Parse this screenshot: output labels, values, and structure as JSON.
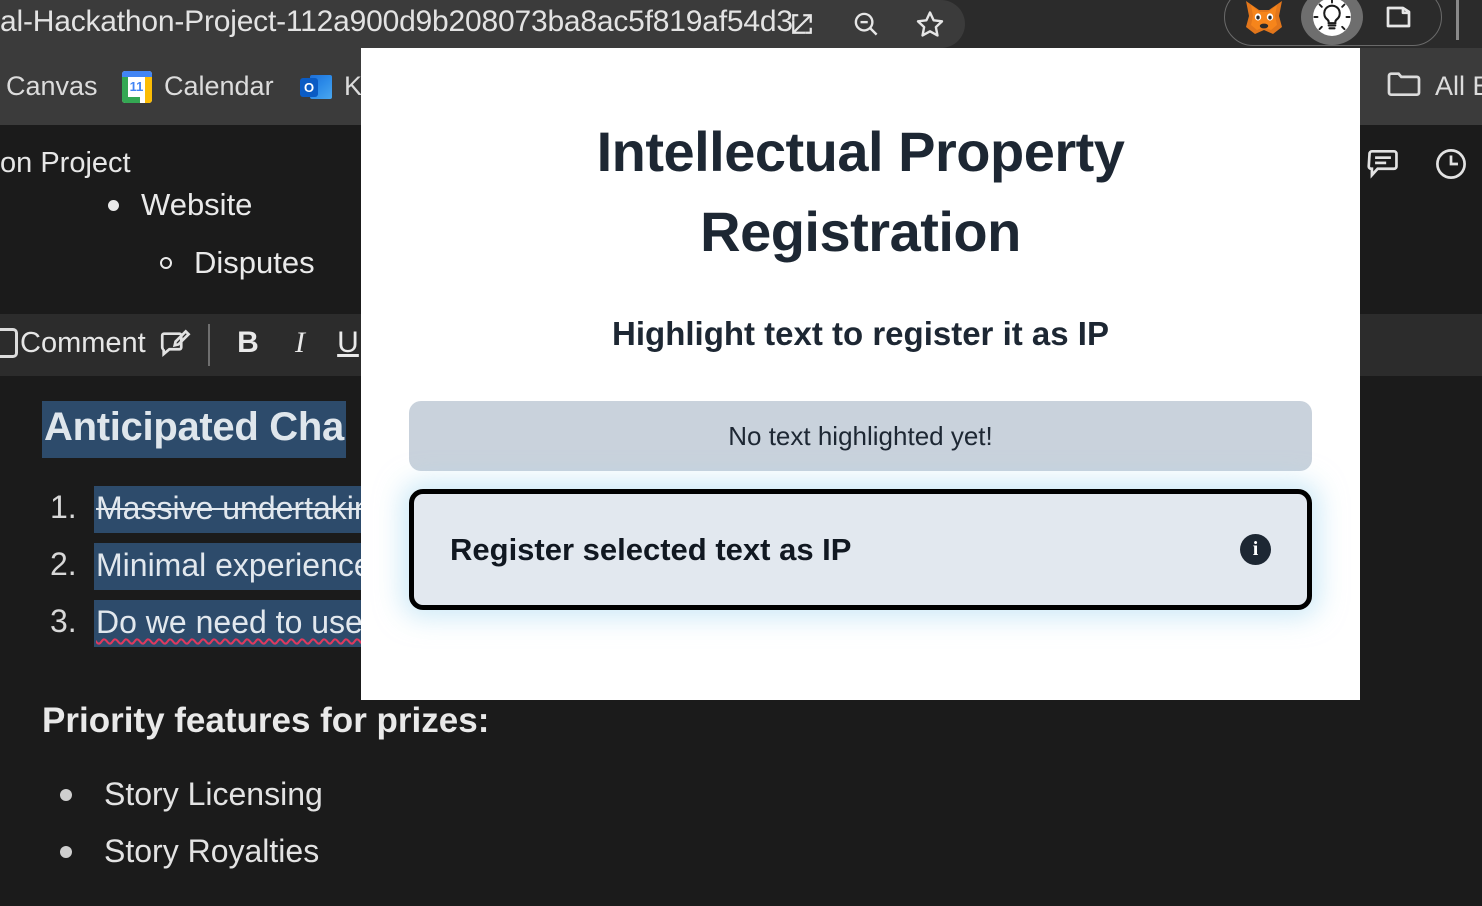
{
  "browser": {
    "url": "al-Hackathon-Project-112a900d9b208073ba8ac5f819af54d3",
    "toolbar_icons": [
      {
        "name": "open-in-new-icon",
        "label": "Open in new window"
      },
      {
        "name": "zoom-out-icon",
        "label": "Zoom out"
      },
      {
        "name": "bookmark-star-icon",
        "label": "Bookmark this tab"
      }
    ],
    "extensions": [
      {
        "name": "metamask-fox-icon",
        "label": "MetaMask",
        "active": false
      },
      {
        "name": "lightbulb-icon",
        "label": "Lightbulb Extension",
        "active": true
      },
      {
        "name": "extension-puzzle-icon",
        "label": "Extensions",
        "active": false
      }
    ]
  },
  "bookmarks": {
    "items": [
      {
        "label": "Canvas",
        "icon": ""
      },
      {
        "label": "Calendar",
        "icon": "google-calendar-icon",
        "day": "11"
      },
      {
        "label": "K",
        "icon": "outlook-icon"
      }
    ],
    "all_bookmarks_label": "All B",
    "all_bookmarks_icon": "folder-icon"
  },
  "document": {
    "breadcrumb": "on Project",
    "outline": [
      {
        "label": "Website",
        "bullet": "filled"
      },
      {
        "label": "Disputes",
        "bullet": "hollow"
      }
    ],
    "toolbar": {
      "comment_label": "Comment",
      "add_comment_icon": "comment-edit-icon",
      "bold_label": "B",
      "italic_label": "I",
      "underline_label": "U"
    },
    "right_icons": [
      {
        "name": "comments-panel-icon"
      },
      {
        "name": "version-history-clock-icon"
      }
    ],
    "heading": "Anticipated Cha",
    "numbered_list": [
      {
        "number": "1.",
        "text": "Massive undertaking",
        "strikethrough": true
      },
      {
        "number": "2.",
        "text": "Minimal experience v",
        "strikethrough": false
      },
      {
        "number": "3.",
        "text": "Do we need to use L",
        "strikethrough": false,
        "spellcheck_error": "L"
      }
    ],
    "priority_heading": "Priority features for prizes:",
    "priority_items": [
      "Story Licensing",
      "Story Royalties"
    ]
  },
  "modal": {
    "title": "Intellectual Property Registration",
    "subtitle": "Highlight text to register it as IP",
    "highlight_status": "No text highlighted yet!",
    "register_button_label": "Register selected text as IP",
    "info_icon_label": "i"
  },
  "colors": {
    "modal_bg": "#ffffff",
    "title_text": "#1d2733",
    "status_bg": "#c9d2dc",
    "button_bg": "#e2e8ef",
    "button_border": "#000000",
    "button_glow": "#a8d8f0",
    "selection_highlight": "#2d4b6b",
    "page_bg": "#1b1b1b",
    "chrome_bg": "#2b2b2b",
    "bookmarkbar_bg": "#3b3b3b",
    "toolbar_bg": "#2c2c2c",
    "spellcheck_underline": "#e0395e"
  }
}
